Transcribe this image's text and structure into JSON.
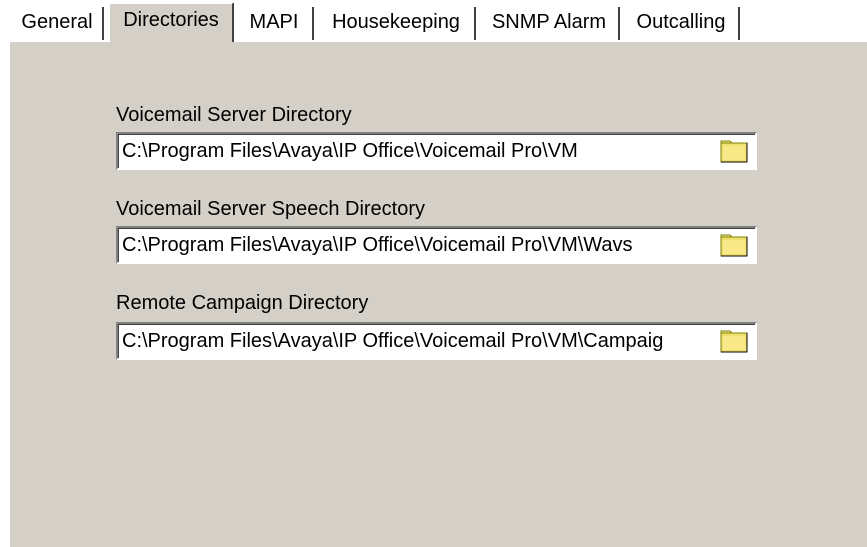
{
  "tabs": [
    {
      "label": "General",
      "active": false
    },
    {
      "label": "Directories",
      "active": true
    },
    {
      "label": "MAPI",
      "active": false
    },
    {
      "label": "Housekeeping",
      "active": false
    },
    {
      "label": "SNMP Alarm",
      "active": false
    },
    {
      "label": "Outcalling",
      "active": false
    }
  ],
  "fields": [
    {
      "label": "Voicemail Server Directory",
      "value": "C:\\Program Files\\Avaya\\IP Office\\Voicemail Pro\\VM",
      "icon": "folder-icon"
    },
    {
      "label": "Voicemail Server Speech Directory",
      "value": "C:\\Program Files\\Avaya\\IP Office\\Voicemail Pro\\VM\\Wavs",
      "icon": "folder-icon"
    },
    {
      "label": "Remote Campaign Directory",
      "value": "C:\\Program Files\\Avaya\\IP Office\\Voicemail Pro\\VM\\Campaig",
      "icon": "folder-icon"
    }
  ],
  "colors": {
    "panel": "#d4d0c8",
    "folder": "#f0e070"
  }
}
